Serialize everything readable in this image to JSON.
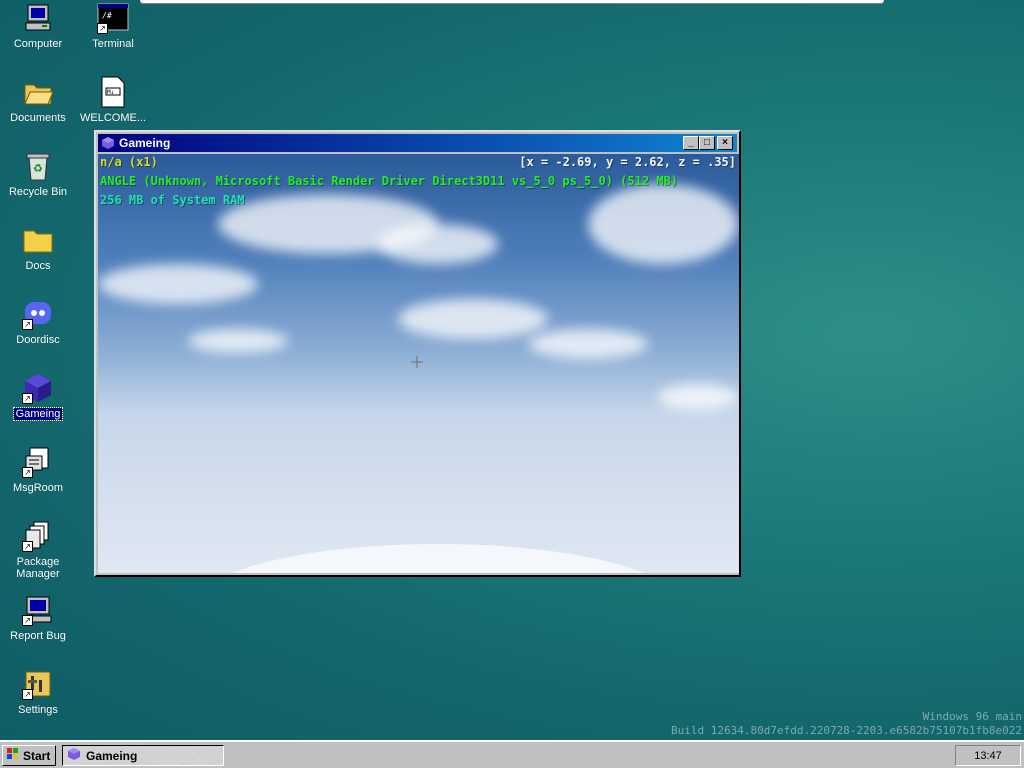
{
  "desktop": {
    "icons": [
      {
        "label": "Computer"
      },
      {
        "label": "Terminal"
      },
      {
        "label": "Documents"
      },
      {
        "label": "WELCOME..."
      },
      {
        "label": "Recycle Bin"
      },
      {
        "label": "Docs"
      },
      {
        "label": "Doordisc"
      },
      {
        "label": "Gameing"
      },
      {
        "label": "MsgRoom"
      },
      {
        "label": "Package Manager"
      },
      {
        "label": "Report Bug"
      },
      {
        "label": "Settings"
      }
    ],
    "watermark": {
      "line1": "Windows 96 main",
      "line2": "Build 12634.80d7efdd.220728-2203.e6582b75107b1fb8e022"
    },
    "colors": {
      "desktop": "#13666b",
      "titlebar": "#000080",
      "hud_green": "#00ff00",
      "hud_yellow": "#d8d820",
      "hud_teal": "#20e0b0"
    }
  },
  "window": {
    "title": "Gameing",
    "buttons": {
      "minimize": "_",
      "maximize": "□",
      "close": "×"
    },
    "hud": {
      "mode": "n/a (x1)",
      "coords": "[x = -2.69, y = 2.62, z = .35]",
      "renderer": "ANGLE (Unknown, Microsoft Basic Render Driver Direct3D11 vs_5_0 ps_5_0) (512 MB)",
      "ram": "256 MB of System RAM"
    }
  },
  "taskbar": {
    "start_label": "Start",
    "tasks": [
      {
        "label": "Gameing"
      }
    ],
    "clock": "13:47"
  }
}
